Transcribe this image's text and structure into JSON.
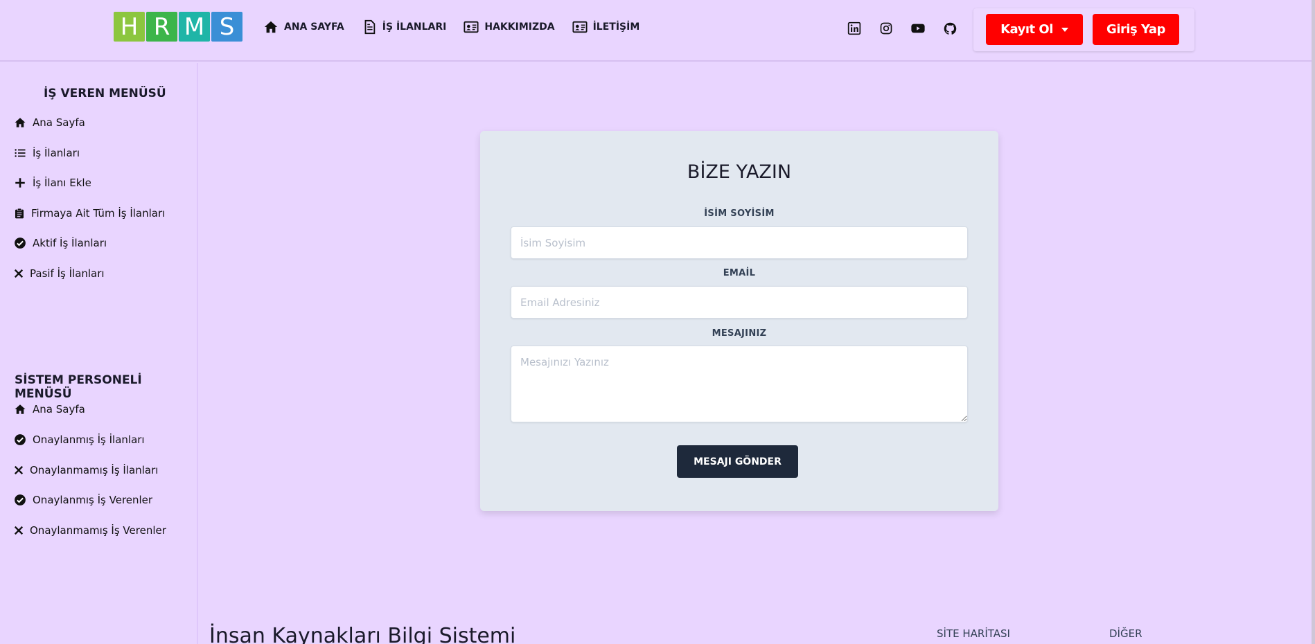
{
  "header": {
    "logo_letters": [
      {
        "char": "H",
        "color": "#8cc63f"
      },
      {
        "char": "R",
        "color": "#3cb54a"
      },
      {
        "char": "M",
        "color": "#1fb5a7"
      },
      {
        "char": "S",
        "color": "#3a8fd6"
      }
    ],
    "nav": [
      {
        "label": "ANA SAYFA",
        "icon": "home-icon"
      },
      {
        "label": "İŞ İLANLARI",
        "icon": "file-text-icon"
      },
      {
        "label": "HAKKIMIZDA",
        "icon": "id-card-icon"
      },
      {
        "label": "İLETİŞİM",
        "icon": "id-card-icon"
      }
    ],
    "social": [
      "linkedin-icon",
      "instagram-icon",
      "youtube-icon",
      "github-icon"
    ],
    "register_label": "Kayıt Ol",
    "login_label": "Giriş Yap",
    "accent_color": "#ff0000"
  },
  "sidebar": {
    "employer_title": "İŞ VEREN MENÜSÜ",
    "employer_items": [
      {
        "label": "Ana Sayfa",
        "icon": "home-icon"
      },
      {
        "label": "İş İlanları",
        "icon": "list-icon"
      },
      {
        "label": "İş İlanı Ekle",
        "icon": "plus-icon"
      },
      {
        "label": "Firmaya Ait Tüm İş İlanları",
        "icon": "clipboard-icon"
      },
      {
        "label": "Aktif İş İlanları",
        "icon": "check-circle-icon"
      },
      {
        "label": "Pasif İş İlanları",
        "icon": "x-icon"
      }
    ],
    "staff_title": "SİSTEM PERSONELİ MENÜSÜ",
    "staff_items": [
      {
        "label": "Ana Sayfa",
        "icon": "home-icon"
      },
      {
        "label": "Onaylanmış İş İlanları",
        "icon": "check-circle-icon"
      },
      {
        "label": "Onaylanmamış İş İlanları",
        "icon": "x-icon"
      },
      {
        "label": "Onaylanmış İş Verenler",
        "icon": "check-circle-icon"
      },
      {
        "label": "Onaylanmamış İş Verenler",
        "icon": "x-icon"
      }
    ]
  },
  "contact": {
    "title": "BİZE YAZIN",
    "name_label": "İSİM SOYİSİM",
    "name_placeholder": "İsim Soyisim",
    "email_label": "EMAİL",
    "email_placeholder": "Email Adresiniz",
    "message_label": "MESAJINIZ",
    "message_placeholder": "Mesajınızı Yazınız",
    "send_label": "MESAJI GÖNDER"
  },
  "footer": {
    "title": "İnsan Kaynakları Bilgi Sistemi",
    "col1": "SİTE HARİTASI",
    "col2": "DİĞER"
  }
}
